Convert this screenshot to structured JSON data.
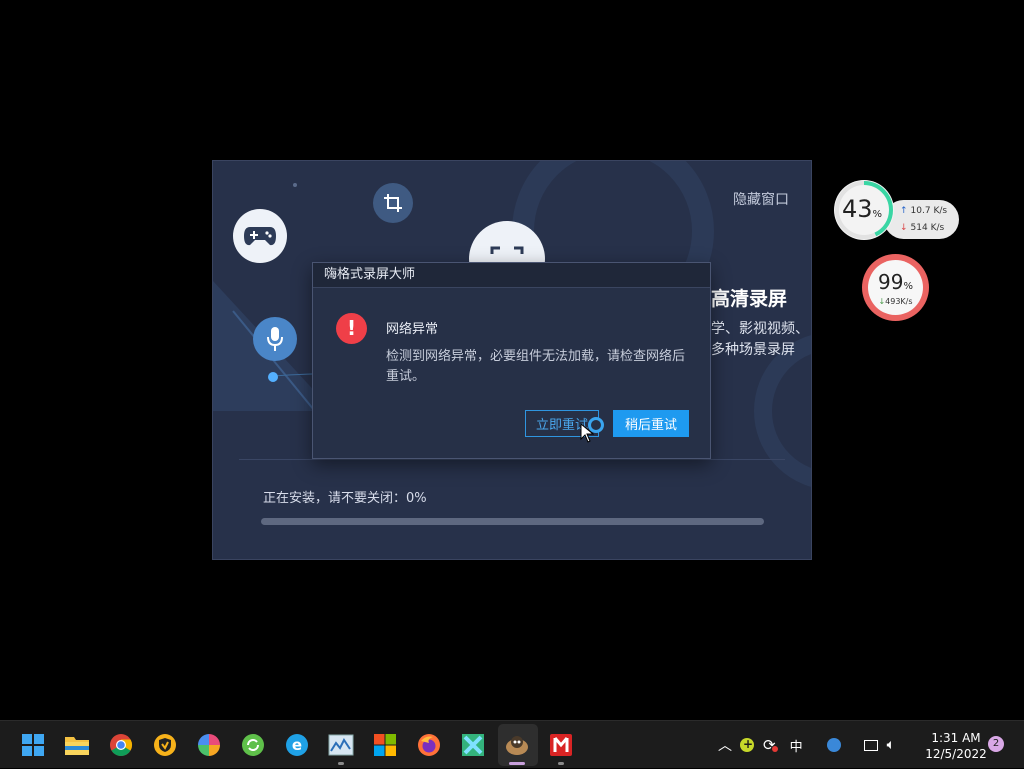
{
  "installer": {
    "hide_window_label": "隐藏窗口",
    "hero_title": "高清录屏",
    "hero_sub_line1": "学、影视视频、",
    "hero_sub_line2": "多种场景录屏",
    "progress_label": "正在安装，请不要关闭：0%",
    "progress_fraction": 0
  },
  "dialog": {
    "title": "嗨格式录屏大师",
    "heading": "网络异常",
    "message": "检测到网络异常，必要组件无法加载，请检查网络后重试。",
    "retry_now_label": "立即重试",
    "retry_later_label": "稍后重试"
  },
  "net_widget": {
    "cpu_percent": "43",
    "percent_sign": "%",
    "upload": "10.7 K/s",
    "download": "514 K/s"
  },
  "mem_widget": {
    "percent": "99",
    "percent_sign": "%",
    "download": "493K/s"
  },
  "taskbar": {
    "ime_label": "中",
    "time": "1:31 AM",
    "date": "12/5/2022",
    "notification_count": "2"
  },
  "colors": {
    "accent_blue": "#1e9af0",
    "error_red": "#ef3f48",
    "installer_bg": "#27314a"
  }
}
